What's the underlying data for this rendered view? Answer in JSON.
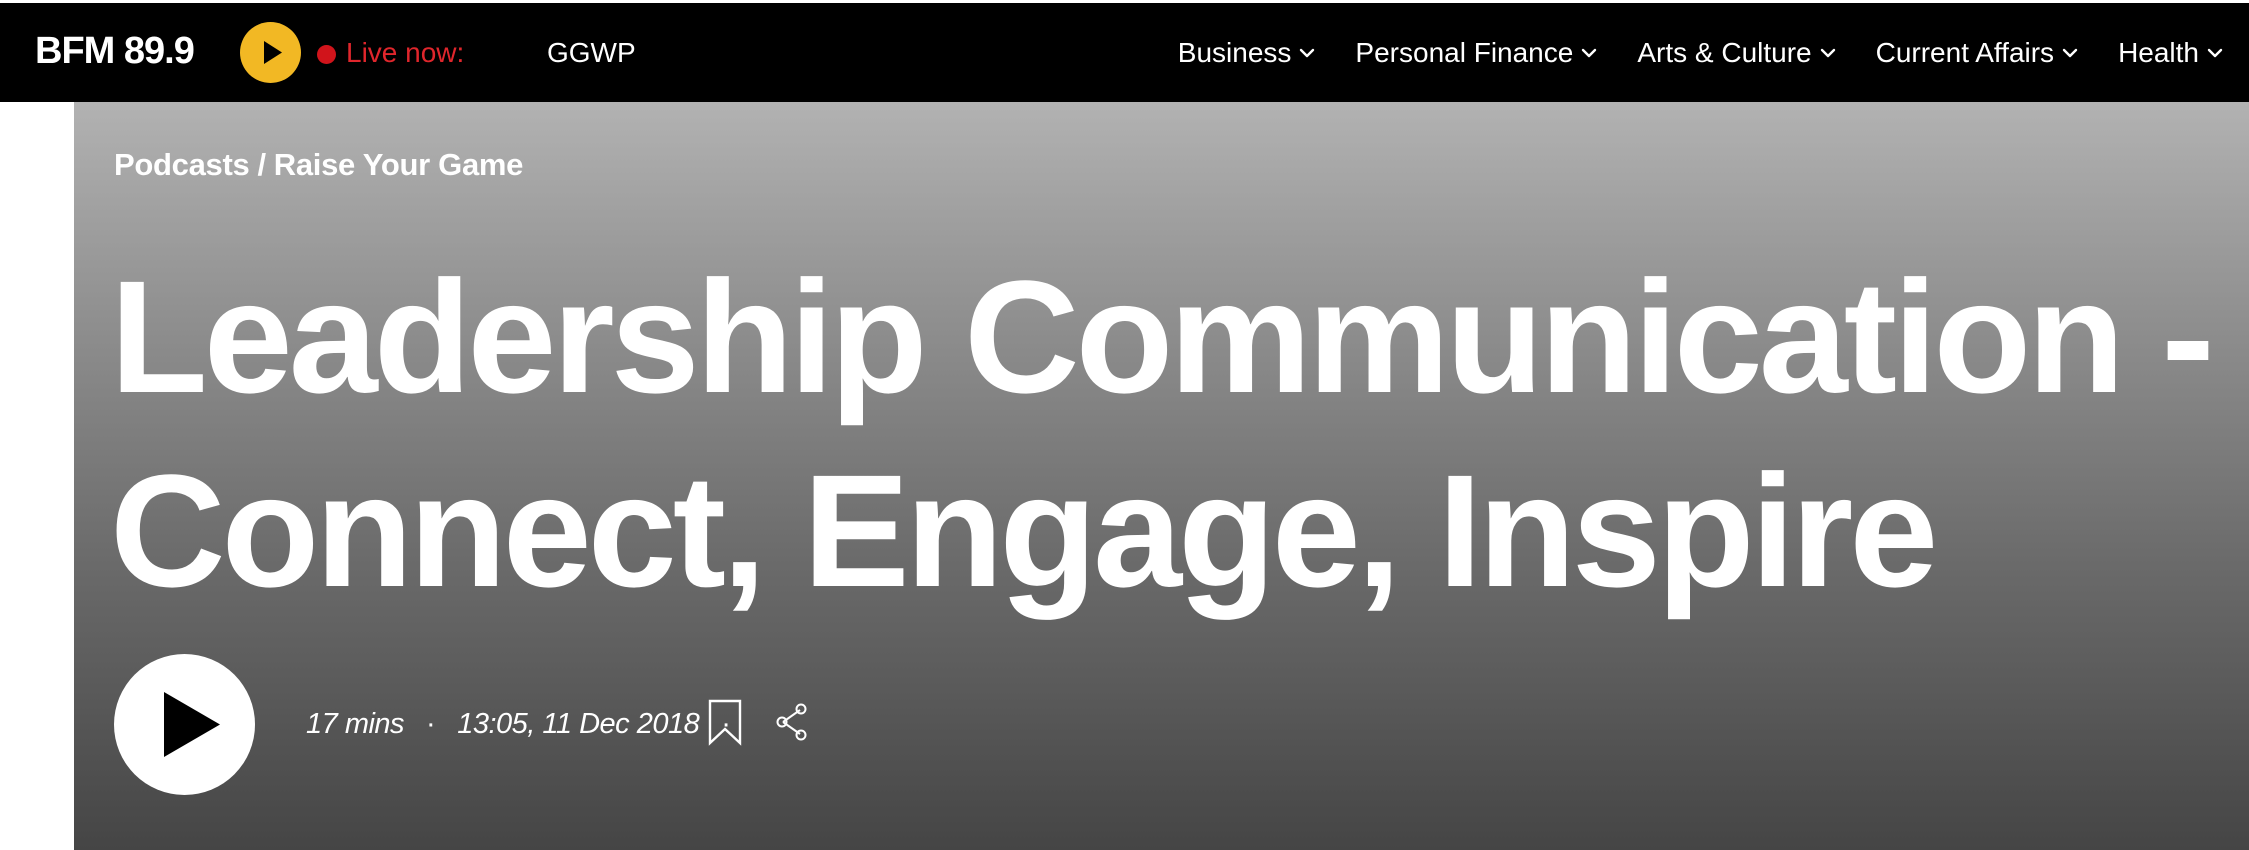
{
  "header": {
    "logo_text": "BFM 89.9",
    "live_label": "Live now:",
    "live_show": "GGWP",
    "live_play_icon": "play-icon",
    "nav": [
      {
        "label": "Business",
        "icon": "chevron-down-icon"
      },
      {
        "label": "Personal Finance",
        "icon": "chevron-down-icon"
      },
      {
        "label": "Arts & Culture",
        "icon": "chevron-down-icon"
      },
      {
        "label": "Current Affairs",
        "icon": "chevron-down-icon"
      },
      {
        "label": "Health",
        "icon": "chevron-down-icon"
      }
    ]
  },
  "hero": {
    "breadcrumb": {
      "section": "Podcasts",
      "separator": "/",
      "show": "Raise Your Game"
    },
    "title": "Leadership Communication - Connect, Engage, Inspire",
    "duration": "17 mins",
    "meta_separator": "·",
    "published": "13:05, 11 Dec 2018",
    "actions": {
      "play_icon": "play-icon",
      "bookmark_icon": "bookmark-icon",
      "share_icon": "share-icon"
    }
  },
  "colors": {
    "topbar_bg": "#000000",
    "live_button": "#f2b824",
    "live_accent": "#e0262c",
    "hero_gradient_top": "#b2b2b2",
    "hero_gradient_bottom": "#454545",
    "text": "#ffffff"
  }
}
